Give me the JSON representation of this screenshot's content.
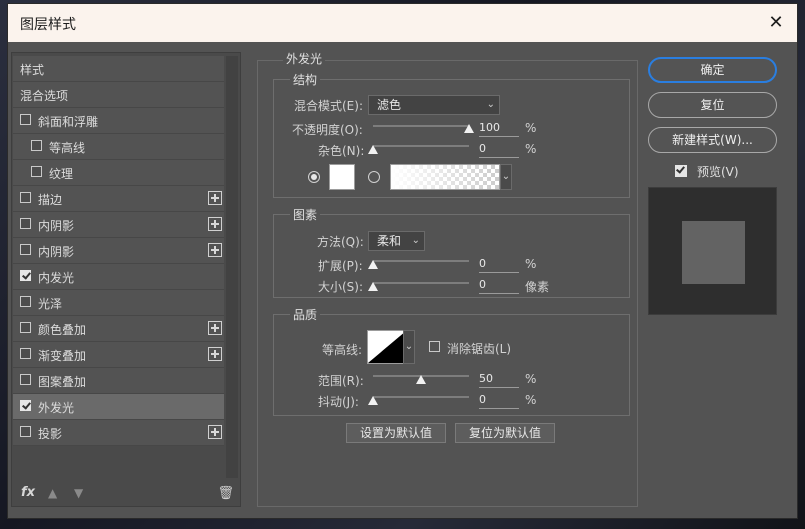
{
  "window": {
    "title": "图层样式",
    "close_icon": "close-icon"
  },
  "left": {
    "header": "样式",
    "blend_options": "混合选项",
    "items": [
      {
        "label": "斜面和浮雕",
        "checked": false,
        "plus": false,
        "indent": 0
      },
      {
        "label": "等高线",
        "checked": false,
        "plus": false,
        "indent": 1
      },
      {
        "label": "纹理",
        "checked": false,
        "plus": false,
        "indent": 1
      },
      {
        "label": "描边",
        "checked": false,
        "plus": true,
        "indent": 0
      },
      {
        "label": "内阴影",
        "checked": false,
        "plus": true,
        "indent": 0
      },
      {
        "label": "内阴影",
        "checked": false,
        "plus": true,
        "indent": 0
      },
      {
        "label": "内发光",
        "checked": true,
        "plus": false,
        "indent": 0
      },
      {
        "label": "光泽",
        "checked": false,
        "plus": false,
        "indent": 0
      },
      {
        "label": "颜色叠加",
        "checked": false,
        "plus": true,
        "indent": 0
      },
      {
        "label": "渐变叠加",
        "checked": false,
        "plus": true,
        "indent": 0
      },
      {
        "label": "图案叠加",
        "checked": false,
        "plus": false,
        "indent": 0
      },
      {
        "label": "外发光",
        "checked": true,
        "plus": false,
        "indent": 0,
        "selected": true
      },
      {
        "label": "投影",
        "checked": false,
        "plus": true,
        "indent": 0
      }
    ],
    "footer": {
      "fx": "fx",
      "up": "▲",
      "down": "▼",
      "trash_icon": "trash-icon"
    }
  },
  "main": {
    "title": "外发光",
    "structure": {
      "title": "结构",
      "blend_mode_label": "混合模式(E):",
      "blend_mode_value": "滤色",
      "opacity_label": "不透明度(O):",
      "opacity_value": "100",
      "opacity_fraction": 1.0,
      "noise_label": "杂色(N):",
      "noise_value": "0",
      "noise_fraction": 0.0,
      "percent": "%"
    },
    "elements": {
      "title": "图素",
      "method_label": "方法(Q):",
      "method_value": "柔和",
      "spread_label": "扩展(P):",
      "spread_value": "0",
      "spread_fraction": 0.0,
      "size_label": "大小(S):",
      "size_value": "0",
      "size_fraction": 0.0,
      "percent": "%",
      "px_unit": "像素"
    },
    "quality": {
      "title": "品质",
      "contour_label": "等高线:",
      "antialias_label": "消除锯齿(L)",
      "range_label": "范围(R):",
      "range_value": "50",
      "range_fraction": 0.5,
      "jitter_label": "抖动(J):",
      "jitter_value": "0",
      "jitter_fraction": 0.0,
      "percent": "%"
    },
    "buttons": {
      "set_default": "设置为默认值",
      "reset_default": "复位为默认值"
    }
  },
  "right": {
    "ok": "确定",
    "reset": "复位",
    "new_style": "新建样式(W)...",
    "preview_label": "预览(V)",
    "preview_checked": true
  }
}
